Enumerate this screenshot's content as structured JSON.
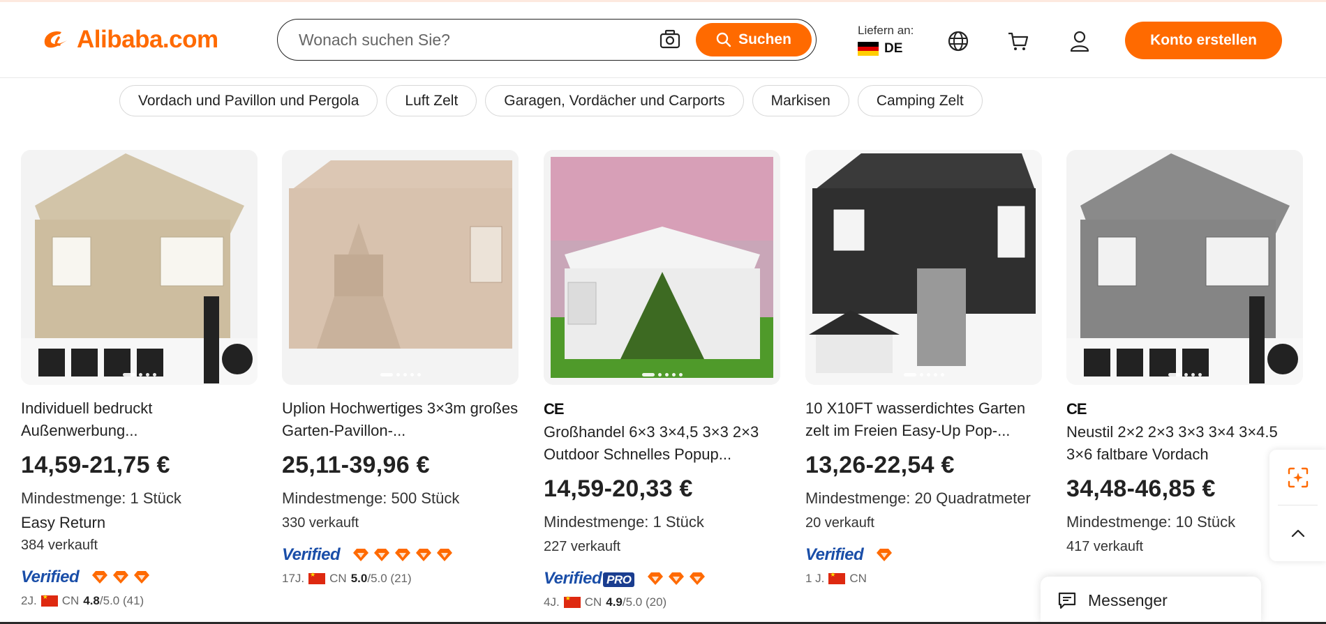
{
  "header": {
    "logo_text": "Alibaba.com",
    "search_placeholder": "Wonach suchen Sie?",
    "search_button": "Suchen",
    "deliver_label": "Liefern an:",
    "deliver_country": "DE",
    "signup_button": "Konto erstellen",
    "icons": [
      "camera-icon",
      "search-icon",
      "globe-icon",
      "cart-icon",
      "user-icon"
    ]
  },
  "categories": [
    "Vordach und Pavillon und Pergola",
    "Luft Zelt",
    "Garagen, Vordächer und Carports",
    "Markisen",
    "Camping Zelt"
  ],
  "products": [
    {
      "ce": "",
      "title": "Individuell bedruckt Außenwerbung...",
      "price": "14,59-21,75 €",
      "moq": "Mindestmenge: 1 Stück",
      "extra": "Easy Return",
      "sold": "384 verkauft",
      "verified": "Verified",
      "pro": "",
      "diamonds": 3,
      "years": "2J.",
      "country": "CN",
      "rating": "4.8",
      "rating_suffix": "/5.0 (41)"
    },
    {
      "ce": "",
      "title": "Uplion Hochwertiges 3×3m großes Garten-Pavillon-...",
      "price": "25,11-39,96 €",
      "moq": "Mindestmenge: 500 Stück",
      "extra": "",
      "sold": "330 verkauft",
      "verified": "Verified",
      "pro": "",
      "diamonds": 5,
      "years": "17J.",
      "country": "CN",
      "rating": "5.0",
      "rating_suffix": "/5.0 (21)"
    },
    {
      "ce": "CE",
      "title": "Großhandel 6×3 3×4,5 3×3 2×3 Outdoor Schnelles Popup...",
      "price": "14,59-20,33 €",
      "moq": "Mindestmenge: 1 Stück",
      "extra": "",
      "sold": "227 verkauft",
      "verified": "Verified",
      "pro": "PRO",
      "diamonds": 3,
      "years": "4J.",
      "country": "CN",
      "rating": "4.9",
      "rating_suffix": "/5.0 (20)"
    },
    {
      "ce": "",
      "title": "10 X10FT wasserdichtes Garten zelt im Freien Easy-Up Pop-...",
      "price": "13,26-22,54 €",
      "moq": "Mindestmenge: 20 Quadratmeter",
      "extra": "",
      "sold": "20 verkauft",
      "verified": "Verified",
      "pro": "",
      "diamonds": 1,
      "years": "1 J.",
      "country": "CN",
      "rating": "",
      "rating_suffix": ""
    },
    {
      "ce": "CE",
      "title": "Neustil 2×2 2×3 3×3 3×4 3×4.5 3×6 faltbare Vordach",
      "price": "34,48-46,85 €",
      "moq": "Mindestmenge: 10 Stück",
      "extra": "",
      "sold": "417 verkauft",
      "verified": "",
      "pro": "",
      "diamonds": 0,
      "years": "",
      "country": "",
      "rating": "",
      "rating_suffix": ""
    }
  ],
  "messenger": {
    "label": "Messenger"
  },
  "colors": {
    "brand": "#ff6a00",
    "verified_blue": "#1a4ea8",
    "text": "#222222"
  }
}
